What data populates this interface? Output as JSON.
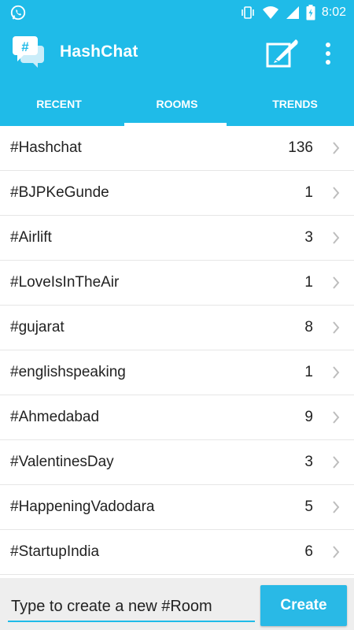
{
  "status_bar": {
    "time": "8:02",
    "icons": [
      "whatsapp-icon",
      "vibrate-icon",
      "wifi-icon",
      "signal-icon",
      "battery-icon"
    ]
  },
  "app_bar": {
    "title": "HashChat",
    "logo_icon": "hashtag-chat-bubble-icon",
    "actions": [
      "compose-icon",
      "overflow-menu-icon"
    ]
  },
  "tabs": [
    {
      "label": "RECENT",
      "selected": false
    },
    {
      "label": "ROOMS",
      "selected": true
    },
    {
      "label": "TRENDS",
      "selected": false
    }
  ],
  "rooms": [
    {
      "name": "#Hashchat",
      "count": "136"
    },
    {
      "name": "#BJPKeGunde",
      "count": "1"
    },
    {
      "name": "#Airlift",
      "count": "3"
    },
    {
      "name": "#LoveIsInTheAir",
      "count": "1"
    },
    {
      "name": "#gujarat",
      "count": "8"
    },
    {
      "name": "#englishspeaking",
      "count": "1"
    },
    {
      "name": "#Ahmedabad",
      "count": "9"
    },
    {
      "name": "#ValentinesDay",
      "count": "3"
    },
    {
      "name": "#HappeningVadodara",
      "count": "5"
    },
    {
      "name": "#StartupIndia",
      "count": "6"
    }
  ],
  "new_room": {
    "placeholder": "Type to create a new #Room",
    "create_label": "Create"
  },
  "colors": {
    "primary": "#1fbbe8",
    "create_button": "#29b9e6"
  }
}
